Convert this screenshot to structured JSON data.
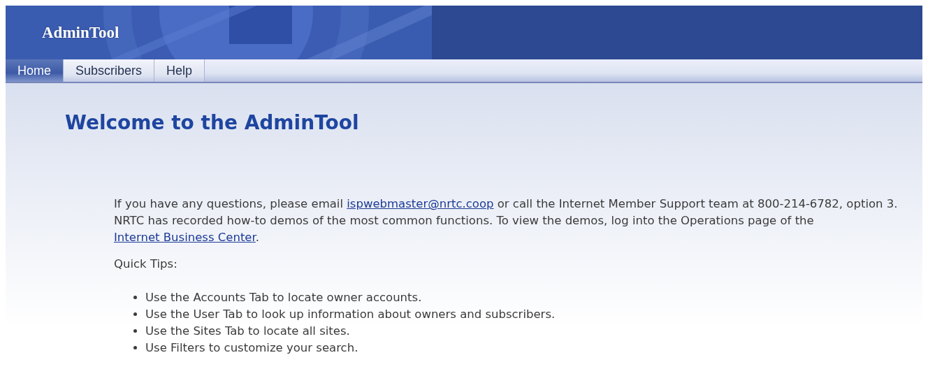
{
  "header": {
    "title": "AdminTool"
  },
  "tabs": [
    {
      "label": "Home",
      "selected": true
    },
    {
      "label": "Subscribers",
      "selected": false
    },
    {
      "label": "Help",
      "selected": false
    }
  ],
  "page_title": "Welcome to the AdminTool",
  "intro": [
    {
      "kind": "text",
      "text": "If you have any questions, please email "
    },
    {
      "kind": "link",
      "text": "ispwebmaster@nrtc.coop"
    },
    {
      "kind": "text",
      "text": " or call the Internet Member Support team at 800-214-6782, option 3. NRTC has recorded how-to demos of the most common functions. To view the demos, log into the Operations page of the "
    },
    {
      "kind": "link",
      "text": "Internet Business Center"
    },
    {
      "kind": "text",
      "text": "."
    }
  ],
  "tips_heading": "Quick Tips:",
  "tips": [
    "Use the Accounts Tab to locate owner accounts.",
    "Use the User Tab to look up information about owners and subscribers.",
    "Use the Sites Tab to locate all sites.",
    "Use Filters to customize your search."
  ]
}
